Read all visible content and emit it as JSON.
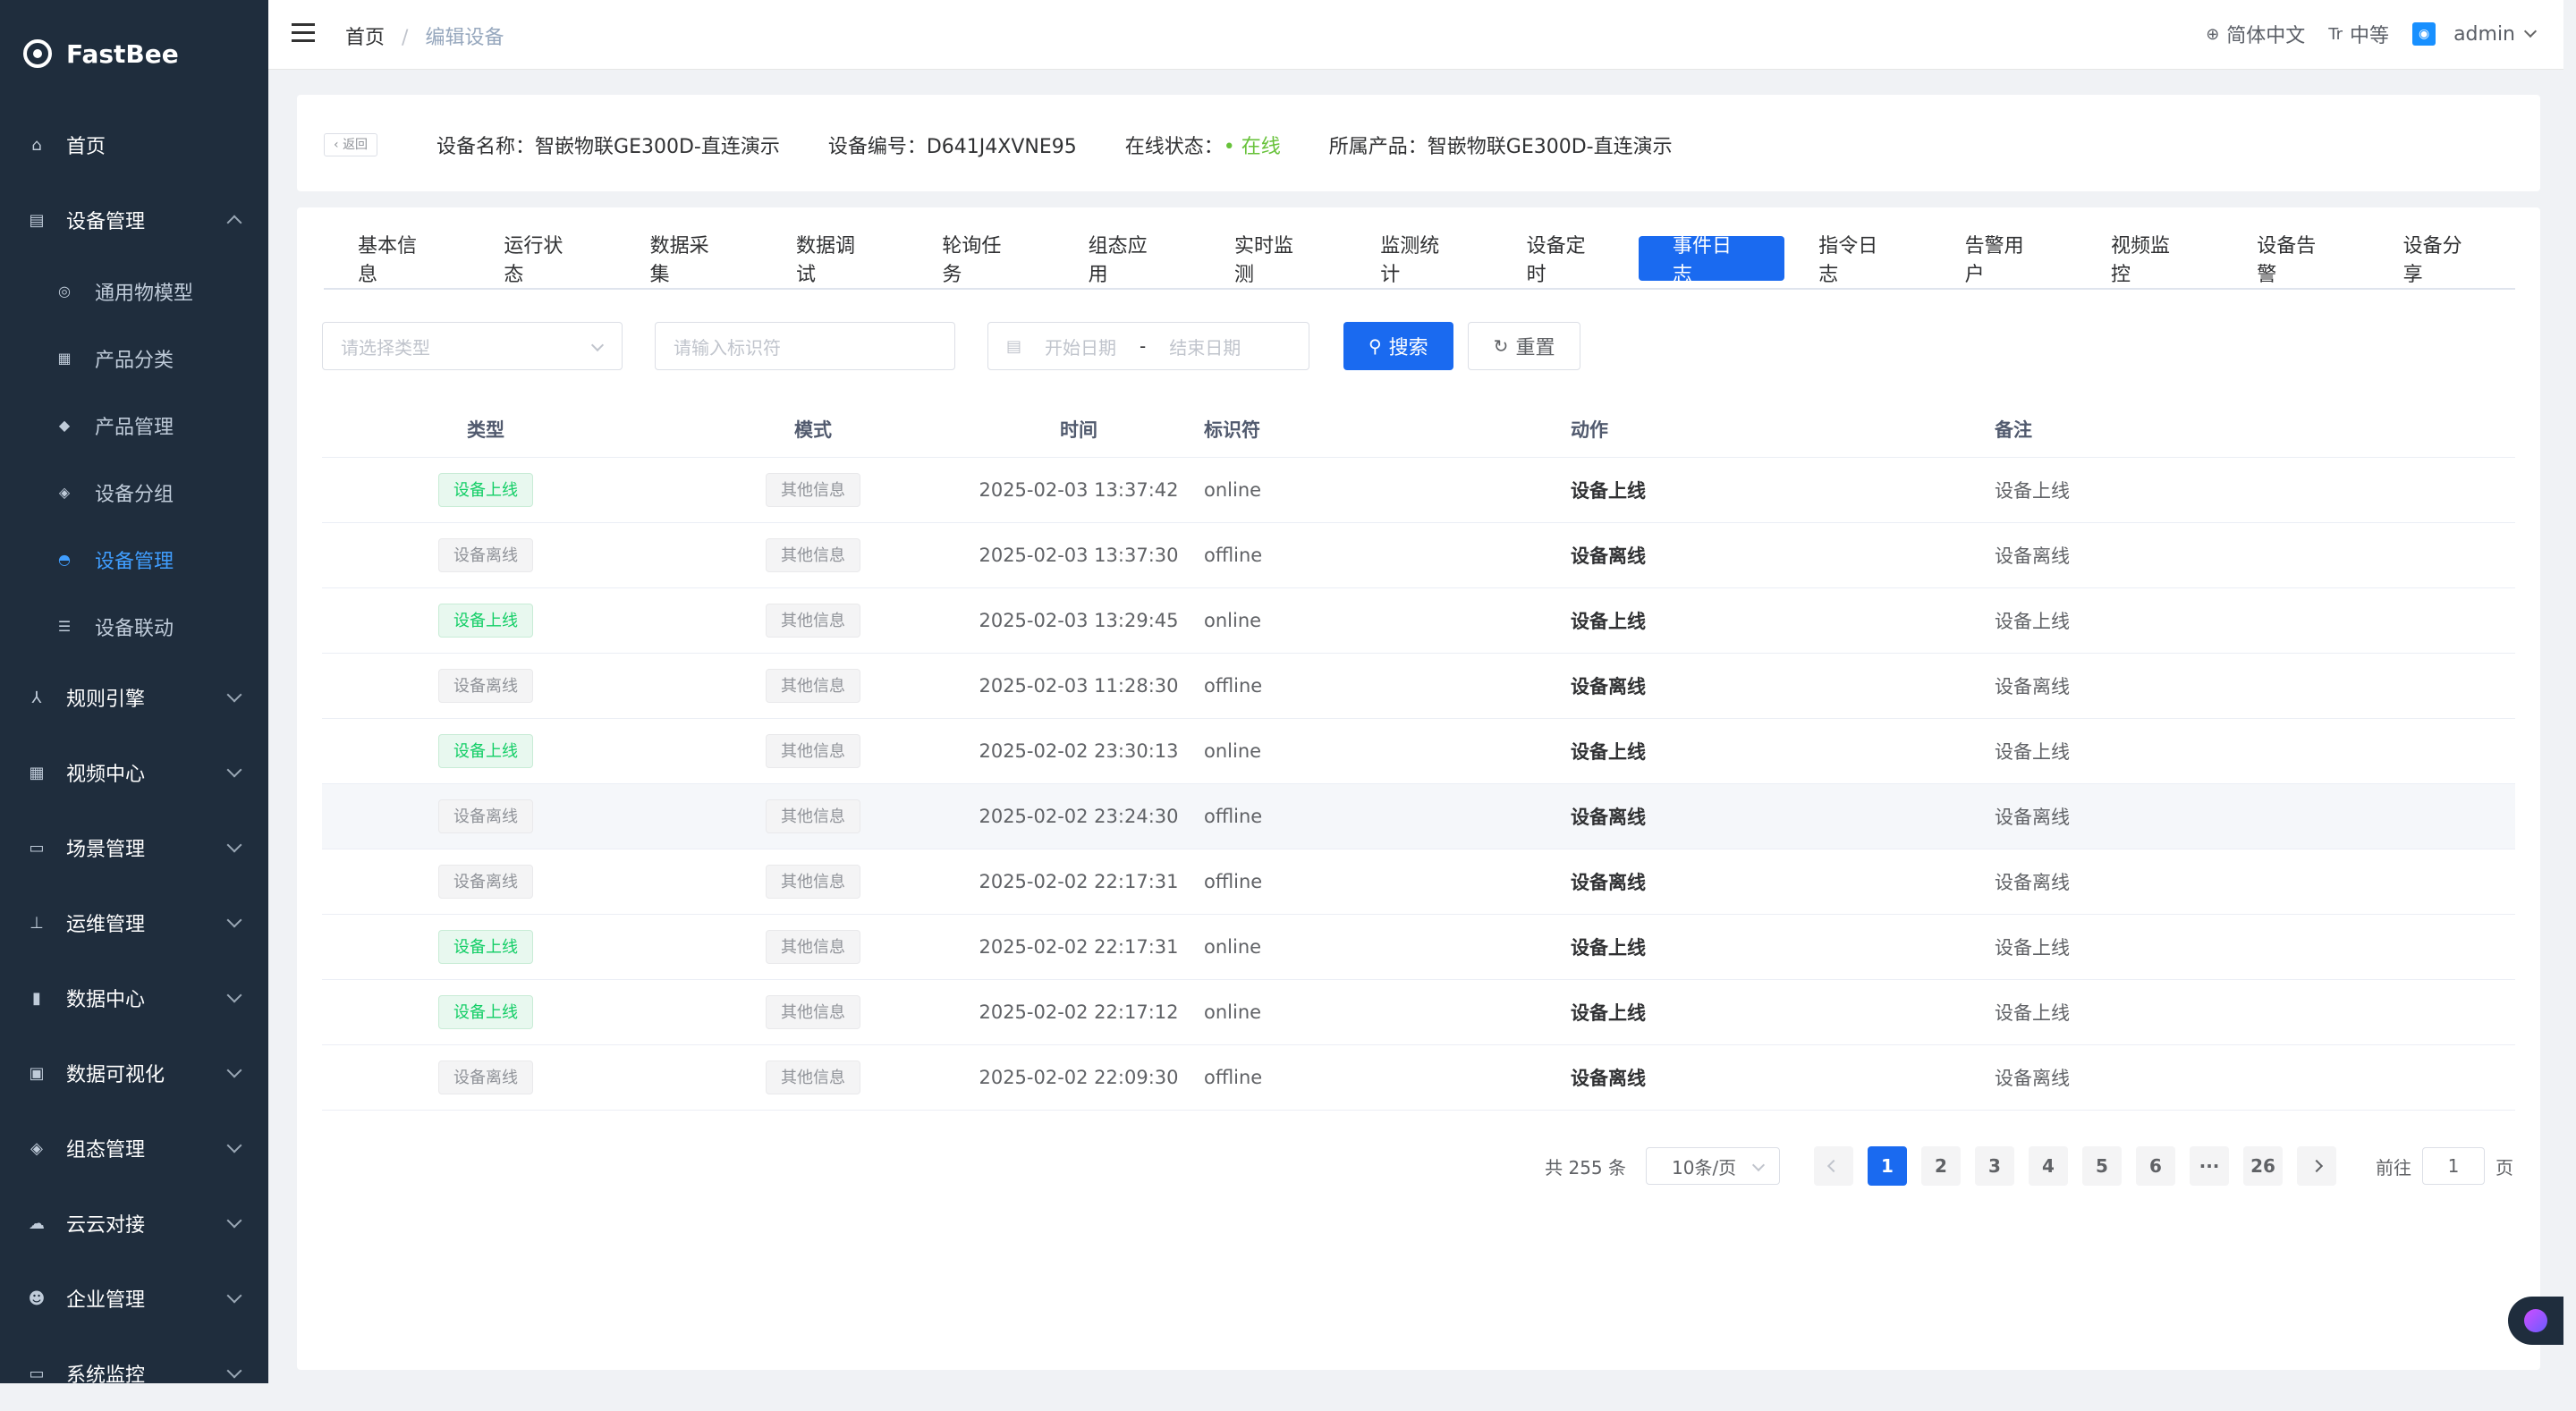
{
  "app": {
    "name": "FastBee"
  },
  "sidebar": {
    "items": [
      {
        "label": "首页",
        "icon": "home-icon"
      },
      {
        "label": "设备管理",
        "icon": "device-icon",
        "expanded": true
      },
      {
        "label": "规则引擎",
        "icon": "rule-icon"
      },
      {
        "label": "视频中心",
        "icon": "video-icon"
      },
      {
        "label": "场景管理",
        "icon": "scene-icon"
      },
      {
        "label": "运维管理",
        "icon": "ops-icon"
      },
      {
        "label": "数据中心",
        "icon": "data-icon"
      },
      {
        "label": "数据可视化",
        "icon": "visual-icon"
      },
      {
        "label": "组态管理",
        "icon": "layers-icon"
      },
      {
        "label": "云云对接",
        "icon": "cloud-icon"
      },
      {
        "label": "企业管理",
        "icon": "enterprise-icon"
      },
      {
        "label": "系统监控",
        "icon": "monitor-icon"
      }
    ],
    "sub_items": [
      {
        "label": "通用物模型"
      },
      {
        "label": "产品分类"
      },
      {
        "label": "产品管理"
      },
      {
        "label": "设备分组"
      },
      {
        "label": "设备管理",
        "active": true
      },
      {
        "label": "设备联动"
      }
    ]
  },
  "header": {
    "breadcrumb": {
      "home": "首页",
      "sep": "/",
      "current": "编辑设备"
    },
    "language": "简体中文",
    "size": "中等",
    "user": "admin"
  },
  "device_info": {
    "back": "返回",
    "name_label": "设备名称：",
    "name": "智嵌物联GE300D-直连演示",
    "serial_label": "设备编号：",
    "serial": "D641J4XVNE95",
    "status_label": "在线状态：",
    "status": "在线",
    "product_label": "所属产品：",
    "product": "智嵌物联GE300D-直连演示"
  },
  "tabs": [
    "基本信息",
    "运行状态",
    "数据采集",
    "数据调试",
    "轮询任务",
    "组态应用",
    "实时监测",
    "监测统计",
    "设备定时",
    "事件日志",
    "指令日志",
    "告警用户",
    "视频监控",
    "设备告警",
    "设备分享"
  ],
  "active_tab": "事件日志",
  "filters": {
    "type_placeholder": "请选择类型",
    "identifier_placeholder": "请输入标识符",
    "start_placeholder": "开始日期",
    "range_sep": "-",
    "end_placeholder": "结束日期",
    "search": "搜索",
    "reset": "重置"
  },
  "table": {
    "headers": [
      "类型",
      "模式",
      "时间",
      "标识符",
      "动作",
      "备注"
    ],
    "rows": [
      {
        "type": "设备上线",
        "mode": "其他信息",
        "time": "2025-02-03 13:37:42",
        "identifier": "online",
        "action": "设备上线",
        "remark": "设备上线"
      },
      {
        "type": "设备离线",
        "mode": "其他信息",
        "time": "2025-02-03 13:37:30",
        "identifier": "offline",
        "action": "设备离线",
        "remark": "设备离线"
      },
      {
        "type": "设备上线",
        "mode": "其他信息",
        "time": "2025-02-03 13:29:45",
        "identifier": "online",
        "action": "设备上线",
        "remark": "设备上线"
      },
      {
        "type": "设备离线",
        "mode": "其他信息",
        "time": "2025-02-03 11:28:30",
        "identifier": "offline",
        "action": "设备离线",
        "remark": "设备离线"
      },
      {
        "type": "设备上线",
        "mode": "其他信息",
        "time": "2025-02-02 23:30:13",
        "identifier": "online",
        "action": "设备上线",
        "remark": "设备上线"
      },
      {
        "type": "设备离线",
        "mode": "其他信息",
        "time": "2025-02-02 23:24:30",
        "identifier": "offline",
        "action": "设备离线",
        "remark": "设备离线"
      },
      {
        "type": "设备离线",
        "mode": "其他信息",
        "time": "2025-02-02 22:17:31",
        "identifier": "offline",
        "action": "设备离线",
        "remark": "设备离线"
      },
      {
        "type": "设备上线",
        "mode": "其他信息",
        "time": "2025-02-02 22:17:31",
        "identifier": "online",
        "action": "设备上线",
        "remark": "设备上线"
      },
      {
        "type": "设备上线",
        "mode": "其他信息",
        "time": "2025-02-02 22:17:12",
        "identifier": "online",
        "action": "设备上线",
        "remark": "设备上线"
      },
      {
        "type": "设备离线",
        "mode": "其他信息",
        "time": "2025-02-02 22:09:30",
        "identifier": "offline",
        "action": "设备离线",
        "remark": "设备离线"
      }
    ]
  },
  "pagination": {
    "total": "共 255 条",
    "page_size": "10条/页",
    "pages": [
      "1",
      "2",
      "3",
      "4",
      "5",
      "6",
      "···",
      "26"
    ],
    "current": "1",
    "goto_prefix": "前往",
    "goto_value": "1",
    "goto_suffix": "页"
  },
  "colors": {
    "sidebar_bg": "#1f2d3d",
    "primary": "#1a6af0",
    "success": "#13ce66",
    "online": "#67c23a"
  }
}
